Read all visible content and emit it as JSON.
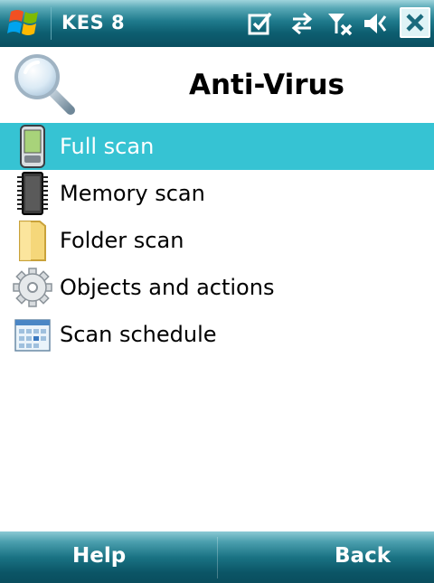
{
  "statusbar": {
    "app_title": "KES 8",
    "icons": [
      "windows-start-icon",
      "notification-check-icon",
      "data-sync-icon",
      "signal-off-icon",
      "volume-icon",
      "close-icon"
    ]
  },
  "header": {
    "title": "Anti-Virus",
    "icon": "magnifier-icon"
  },
  "menu": {
    "items": [
      {
        "label": "Full scan",
        "icon": "device-icon",
        "selected": true
      },
      {
        "label": "Memory scan",
        "icon": "memory-chip-icon",
        "selected": false
      },
      {
        "label": "Folder scan",
        "icon": "folder-icon",
        "selected": false
      },
      {
        "label": "Objects and actions",
        "icon": "gear-icon",
        "selected": false
      },
      {
        "label": "Scan schedule",
        "icon": "calendar-icon",
        "selected": false
      }
    ]
  },
  "softkeys": {
    "left": "Help",
    "right": "Back"
  },
  "colors": {
    "bar_dark": "#0a4f60",
    "selection": "#36c3d3"
  }
}
